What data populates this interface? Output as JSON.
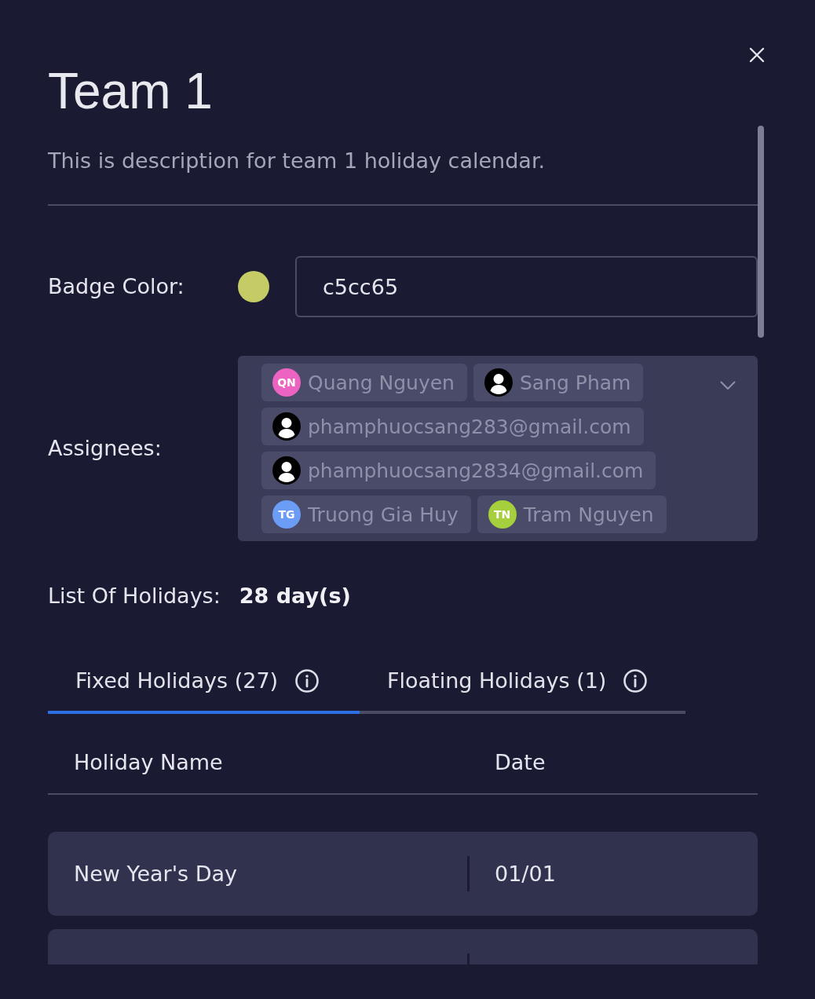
{
  "dialog": {
    "title": "Team 1",
    "description": "This is description for team 1 holiday calendar."
  },
  "badge_color": {
    "label": "Badge Color:",
    "color": "#c5cc65",
    "value": "c5cc65"
  },
  "assignees": {
    "label": "Assignees:",
    "items": [
      {
        "name": "Quang Nguyen",
        "kind": "initials",
        "initials": "QN",
        "color": "#ec63c1"
      },
      {
        "name": "Sang Pham",
        "kind": "generic"
      },
      {
        "name": "phamphuocsang283@gmail.com",
        "kind": "generic"
      },
      {
        "name": "phamphuocsang2834@gmail.com",
        "kind": "generic"
      },
      {
        "name": "Truong Gia Huy",
        "kind": "initials",
        "initials": "TG",
        "color": "#6b9cf6"
      },
      {
        "name": "Tram Nguyen",
        "kind": "initials",
        "initials": "TN",
        "color": "#a6cf3e"
      }
    ]
  },
  "holidays_summary": {
    "label": "List Of Holidays:",
    "value": "28 day(s)"
  },
  "tabs": [
    {
      "label": "Fixed Holidays (27)",
      "selected": true
    },
    {
      "label": "Floating Holidays (1)",
      "selected": false
    }
  ],
  "table": {
    "columns": [
      "Holiday Name",
      "Date"
    ],
    "rows": [
      {
        "name": "New Year's Day",
        "date": "01/01"
      }
    ],
    "more_rows_below": true
  }
}
